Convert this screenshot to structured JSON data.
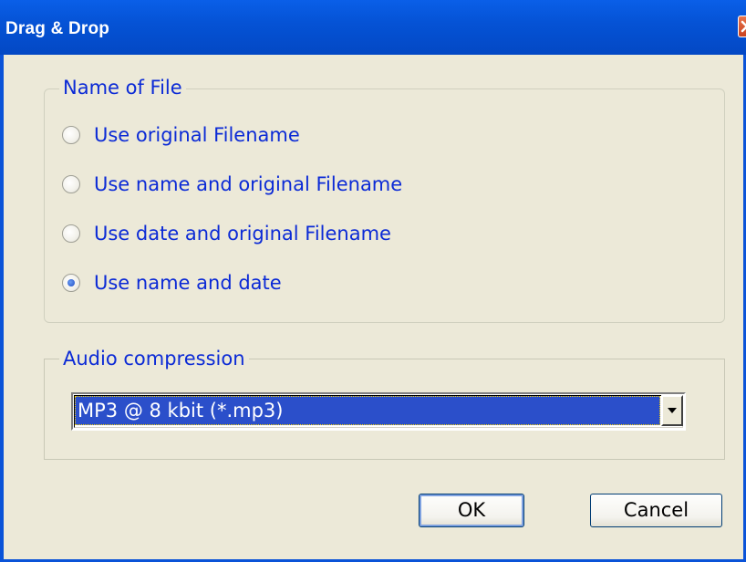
{
  "window": {
    "title": "Drag & Drop",
    "close_icon": "close-icon"
  },
  "name_of_file": {
    "legend": "Name of File",
    "options": [
      {
        "label": "Use original Filename",
        "checked": false
      },
      {
        "label": "Use name and original Filename",
        "checked": false
      },
      {
        "label": "Use date and original Filename",
        "checked": false
      },
      {
        "label": "Use name and date",
        "checked": true
      }
    ]
  },
  "audio_compression": {
    "legend": "Audio compression",
    "selected": "MP3 @  8 kbit (*.mp3)"
  },
  "buttons": {
    "ok": "OK",
    "cancel": "Cancel"
  },
  "colors": {
    "title_bar": "#0553d6",
    "label_text": "#0b2ad6",
    "selection": "#2b4fca",
    "dialog_bg": "#ece9d8"
  }
}
